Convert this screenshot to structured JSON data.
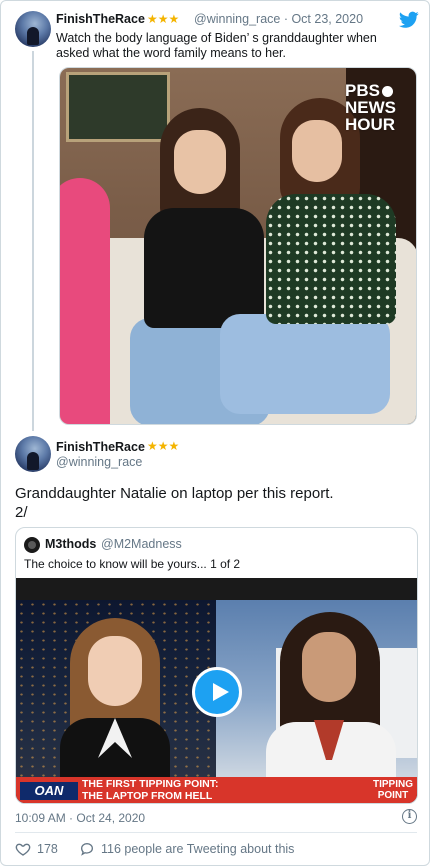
{
  "tweet1": {
    "name": "FinishTheRace",
    "stars": "★★★",
    "handle_date": "@winning_race · Oct 23, 2020",
    "text_line1": "Watch the body language of Biden’ s granddaughter when",
    "text_line2": "asked what the word family means to her.",
    "media_watermark_line1": "PBS",
    "media_watermark_line2": "NEWS",
    "media_watermark_line3": "HOUR"
  },
  "tweet2": {
    "name": "FinishTheRace",
    "stars": "★★★",
    "handle": "@winning_race",
    "text_line1": "Granddaughter Natalie on laptop per this report.",
    "text_line2": "2/"
  },
  "quote": {
    "name": "M3thods",
    "handle": "@M2Madness",
    "text": "The choice to know will be yours... 1 of 2",
    "video": {
      "network": "OAN",
      "lower_third_line1": "THE FIRST TIPPING POINT:",
      "lower_third_line2": "THE LAPTOP FROM HELL",
      "show_line1": "TIPPING",
      "show_line2": "POINT"
    }
  },
  "footer": {
    "timestamp": "10:09 AM · Oct 24, 2020",
    "likes": "178",
    "tweeting": "116 people are Tweeting about this"
  },
  "colors": {
    "twitter_blue": "#1da1f2",
    "star_gold": "#f4b400",
    "muted_text": "#657786",
    "border": "#cfd9de"
  },
  "icons": [
    "twitter-bird-icon",
    "play-icon",
    "info-icon",
    "heart-icon",
    "reply-bubble-icon"
  ]
}
